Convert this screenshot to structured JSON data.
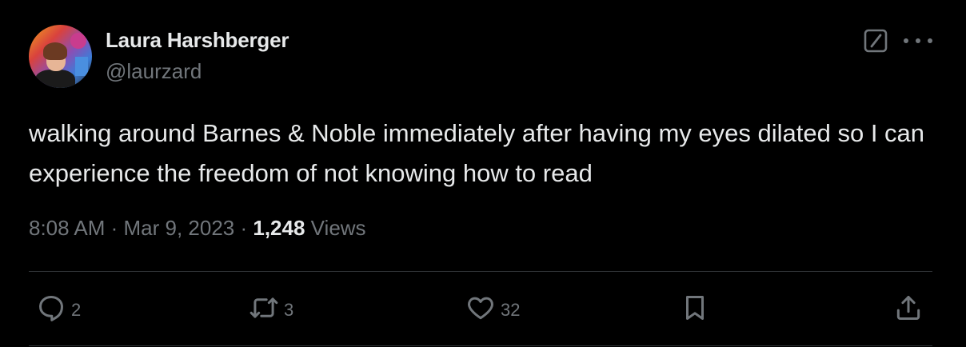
{
  "author": {
    "name": "Laura Harshberger",
    "handle": "@laurzard"
  },
  "tweet": {
    "text": "walking around Barnes & Noble immediately after having my eyes dilated so I can experience the freedom of not knowing how to read",
    "time": "8:08 AM",
    "separator": " · ",
    "date": "Mar 9, 2023",
    "views_count": "1,248",
    "views_label": " Views"
  },
  "actions": {
    "replies": "2",
    "reposts": "3",
    "likes": "32"
  },
  "colors": {
    "background": "#000000",
    "text_primary": "#e7e9ea",
    "text_secondary": "#71767b",
    "divider": "#2f3336"
  },
  "icons": [
    "grok-icon",
    "more-icon",
    "reply-icon",
    "repost-icon",
    "like-icon",
    "bookmark-icon",
    "share-icon"
  ]
}
